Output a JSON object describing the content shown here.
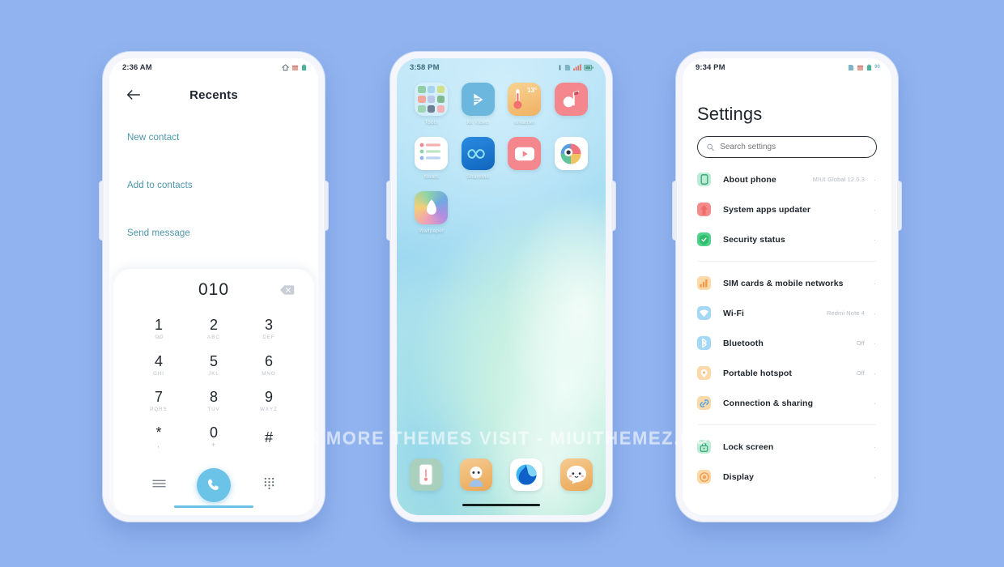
{
  "background_color": "#91b4f0",
  "watermark": "FOR MORE THEMES VISIT - MIUITHEMEZ.COM",
  "phone1": {
    "name": "dialer-recents-screen",
    "statusbar": {
      "time": "2:36 AM",
      "icons": [
        "alarm-icon",
        "calendar-icon",
        "battery-icon"
      ]
    },
    "appbar": {
      "back_icon": "back-arrow-icon",
      "title": "Recents"
    },
    "actions": [
      {
        "label": "New contact"
      },
      {
        "label": "Add to contacts"
      },
      {
        "label": "Send message"
      }
    ],
    "dialer": {
      "number": "010",
      "delete_icon": "backspace-icon",
      "accent_color": "#6bc3e8",
      "keys": [
        {
          "num": "1",
          "sub": "",
          "sub_icon": "voicemail-icon"
        },
        {
          "num": "2",
          "sub": "ABC"
        },
        {
          "num": "3",
          "sub": "DEF"
        },
        {
          "num": "4",
          "sub": "GHI"
        },
        {
          "num": "5",
          "sub": "JKL"
        },
        {
          "num": "6",
          "sub": "MNO"
        },
        {
          "num": "7",
          "sub": "PQRS"
        },
        {
          "num": "8",
          "sub": "TUV"
        },
        {
          "num": "9",
          "sub": "WXYZ"
        },
        {
          "num": "*",
          "sub": ","
        },
        {
          "num": "0",
          "sub": "+"
        },
        {
          "num": "#",
          "sub": ""
        }
      ],
      "bottom": {
        "menu_icon": "menu-lines-icon",
        "call_icon": "phone-handset-icon",
        "keypad_icon": "dialpad-grid-icon"
      }
    }
  },
  "phone2": {
    "name": "home-screen",
    "statusbar": {
      "time": "3:58 PM",
      "icons": [
        "vpn-icon",
        "sim-icon",
        "signal-icon",
        "battery-icon"
      ]
    },
    "apps": [
      {
        "label": "Tools",
        "icon": "tools-folder-icon",
        "type": "folder"
      },
      {
        "label": "Mi Video",
        "icon": "mi-video-icon",
        "color": "#6bb7dd"
      },
      {
        "label": "Weather",
        "icon": "weather-thermometer-icon",
        "color": "#f3c169",
        "badge": "13°"
      },
      {
        "label": "",
        "icon": "music-note-icon",
        "color": "#f4868e"
      },
      {
        "label": "Notes",
        "icon": "notes-icon",
        "color": "#ffffff"
      },
      {
        "label": "ShareMe",
        "icon": "shareme-infinity-icon",
        "color": "#1e7fd4"
      },
      {
        "label": "",
        "icon": "youtube-play-icon",
        "color": "#f4868e"
      },
      {
        "label": "",
        "icon": "color-wheel-icon",
        "color": "#ffffff"
      },
      {
        "label": "Wallpaper",
        "icon": "wallpaper-flower-icon",
        "color": "#d0a2e6"
      }
    ],
    "dock": [
      {
        "icon": "phone-device-icon",
        "color": "#a9cfbd"
      },
      {
        "icon": "contacts-person-icon",
        "color": "#f0bb79"
      },
      {
        "icon": "browser-globe-icon",
        "color": "#ffffff"
      },
      {
        "icon": "messages-face-icon",
        "color": "#f0bb79"
      }
    ]
  },
  "phone3": {
    "name": "settings-screen",
    "statusbar": {
      "time": "9:34 PM",
      "icons": [
        "sim-icon",
        "calendar-icon",
        "battery-icon"
      ],
      "battery_level": "90"
    },
    "title": "Settings",
    "search": {
      "placeholder": "Search settings",
      "icon": "search-icon"
    },
    "groups": [
      {
        "items": [
          {
            "label": "About phone",
            "value": "MIUI Global 12.0.3",
            "icon": "phone-info-icon",
            "color": "#bdebd5"
          },
          {
            "label": "System apps updater",
            "value": "",
            "icon": "up-arrow-icon",
            "color": "#f58a8a"
          },
          {
            "label": "Security status",
            "value": "",
            "icon": "shield-check-icon",
            "color": "#52d08c"
          }
        ]
      },
      {
        "items": [
          {
            "label": "SIM cards & mobile networks",
            "value": "",
            "icon": "sim-signal-icon",
            "color": "#fbd9a8"
          },
          {
            "label": "Wi-Fi",
            "value": "Redmi Note 4",
            "icon": "wifi-icon",
            "color": "#a4d9f5"
          },
          {
            "label": "Bluetooth",
            "value": "Off",
            "icon": "bluetooth-icon",
            "color": "#a4d9f5"
          },
          {
            "label": "Portable hotspot",
            "value": "Off",
            "icon": "hotspot-icon",
            "color": "#fbd9a8"
          },
          {
            "label": "Connection & sharing",
            "value": "",
            "icon": "link-icon",
            "color": "#fbd9a8"
          }
        ]
      },
      {
        "items": [
          {
            "label": "Lock screen",
            "value": "",
            "icon": "lock-icon",
            "color": "#bdebd5"
          },
          {
            "label": "Display",
            "value": "",
            "icon": "display-icon",
            "color": "#fbd9a8"
          }
        ]
      }
    ],
    "arrow_glyph": "·"
  }
}
